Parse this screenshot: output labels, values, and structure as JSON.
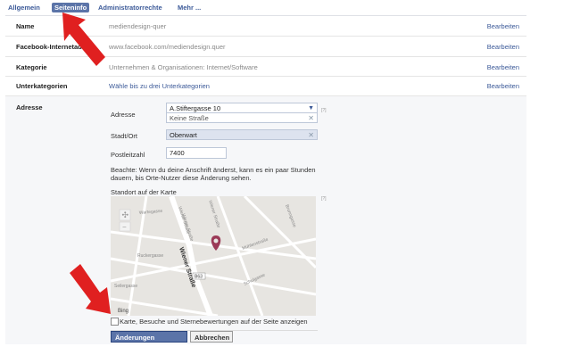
{
  "tabs": [
    "Allgemein",
    "Seiteninfo",
    "Administratorrechte",
    "Mehr ..."
  ],
  "rows": {
    "name": {
      "label": "Name",
      "value": "mediendesign-quer",
      "edit": "Bearbeiten"
    },
    "facebook": {
      "label": "Facebook-Internetadr",
      "value": "www.facebook.com/mediendesign.quer",
      "edit": "Bearbeiten"
    },
    "kategorie": {
      "label": "Kategorie",
      "value": "Unternehmen & Organisationen: Internet/Software",
      "edit": "Bearbeiten"
    },
    "unterkategorien": {
      "label": "Unterkategorien",
      "value": "Wähle bis zu drei Unterkategorien",
      "edit": "Bearbeiten"
    }
  },
  "address": {
    "section_label": "Adresse",
    "adresse_label": "Adresse",
    "adresse_value": "A.Stiftergasse 10",
    "adresse_suggestion": "Keine Straße",
    "help": "[?]",
    "ort_label": "Stadt/Ort",
    "ort_value": "Oberwart",
    "plz_label": "Postleitzahl",
    "plz_value": "7400",
    "note": "Beachte: Wenn du deine Anschrift änderst, kann es ein paar Stunden dauern, bis Orte-Nutzer diese Änderung sehen.",
    "map_label": "Standort auf der Karte",
    "map_help": "[?]",
    "checkbox_label": "Karte, Besuche und Sternebewertungen auf der Seite anzeigen",
    "save_button": "Änderungen speichern",
    "cancel_button": "Abbrechen"
  },
  "map": {
    "streets": [
      "Wiener Straße",
      "Wiener Straße",
      "Mühlenstraße",
      "Wartegasse",
      "Ruckergasse",
      "Wiener Straße",
      "Seilergasse",
      "Schulgasse",
      "Brunngasse"
    ],
    "route_badge": "B63",
    "attribution": "Bing"
  },
  "colors": {
    "link": "#3b5998",
    "button": "#5b74a8",
    "arrow": "#e02020",
    "pin": "#9b3a57"
  }
}
